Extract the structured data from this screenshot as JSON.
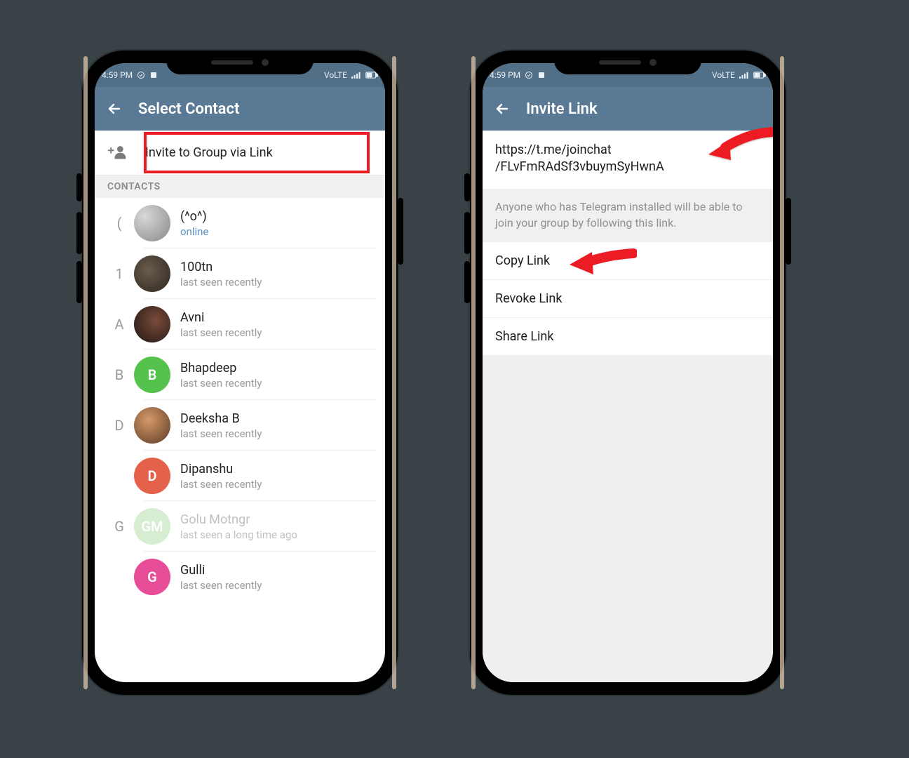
{
  "status": {
    "time": "4:59 PM",
    "right_label": "VoLTE"
  },
  "left": {
    "title": "Select Contact",
    "invite_label": "Invite to Group via Link",
    "contacts_header": "CONTACTS",
    "contacts": [
      {
        "index": "(",
        "name": "(^o^)",
        "status": "online",
        "online": true,
        "letter": "",
        "color": ""
      },
      {
        "index": "1",
        "name": "100tn",
        "status": "last seen recently",
        "online": false,
        "letter": "",
        "color": ""
      },
      {
        "index": "A",
        "name": "Avni",
        "status": "last seen recently",
        "online": false,
        "letter": "",
        "color": ""
      },
      {
        "index": "B",
        "name": "Bhapdeep",
        "status": "last seen recently",
        "online": false,
        "letter": "B",
        "color": "#56c24e"
      },
      {
        "index": "D",
        "name": "Deeksha B",
        "status": "last seen recently",
        "online": false,
        "letter": "",
        "color": ""
      },
      {
        "index": "",
        "name": "Dipanshu",
        "status": "last seen recently",
        "online": false,
        "letter": "D",
        "color": "#e4624c"
      },
      {
        "index": "G",
        "name": "Golu Motngr",
        "status": "last seen a long time ago",
        "online": false,
        "letter": "GM",
        "color": "#bde2b3",
        "faded": true
      },
      {
        "index": "",
        "name": "Gulli",
        "status": "last seen recently",
        "online": false,
        "letter": "G",
        "color": "#e84d9a"
      }
    ]
  },
  "right": {
    "title": "Invite Link",
    "link_line1": "https://t.me/joinchat",
    "link_line2": "/FLvFmRAdSf3vbuymSyHwnA",
    "description": "Anyone who has Telegram installed will be able to join your group by following this link.",
    "actions": {
      "copy": "Copy Link",
      "revoke": "Revoke Link",
      "share": "Share Link"
    }
  }
}
